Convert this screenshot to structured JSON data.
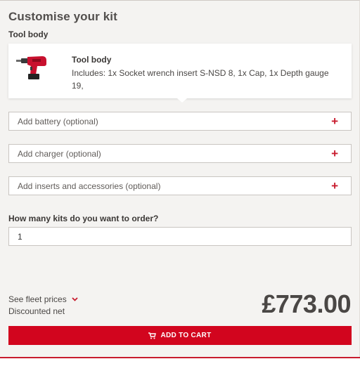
{
  "header": {
    "title": "Customise your kit",
    "subtitle": "Tool body"
  },
  "product": {
    "name": "Tool body",
    "description": "Includes: 1x Socket wrench insert S-NSD 8, 1x Cap, 1x Depth gauge 19,",
    "image_icon": "cordless-drywall-screwdriver"
  },
  "options": [
    {
      "label": "Add battery (optional)",
      "icon": "plus-icon"
    },
    {
      "label": "Add charger (optional)",
      "icon": "plus-icon"
    },
    {
      "label": "Add inserts and accessories (optional)",
      "icon": "plus-icon"
    }
  ],
  "quantity": {
    "label": "How many kits do you want to order?",
    "value": "1"
  },
  "pricing": {
    "fleet_link": "See fleet prices",
    "note": "Discounted net",
    "price": "£773.00"
  },
  "cart": {
    "button_label": "ADD TO CART",
    "icon": "cart-icon"
  },
  "colors": {
    "accent": "#d2051e",
    "panel_bg": "#f4f3f1",
    "text": "#4a4745"
  }
}
